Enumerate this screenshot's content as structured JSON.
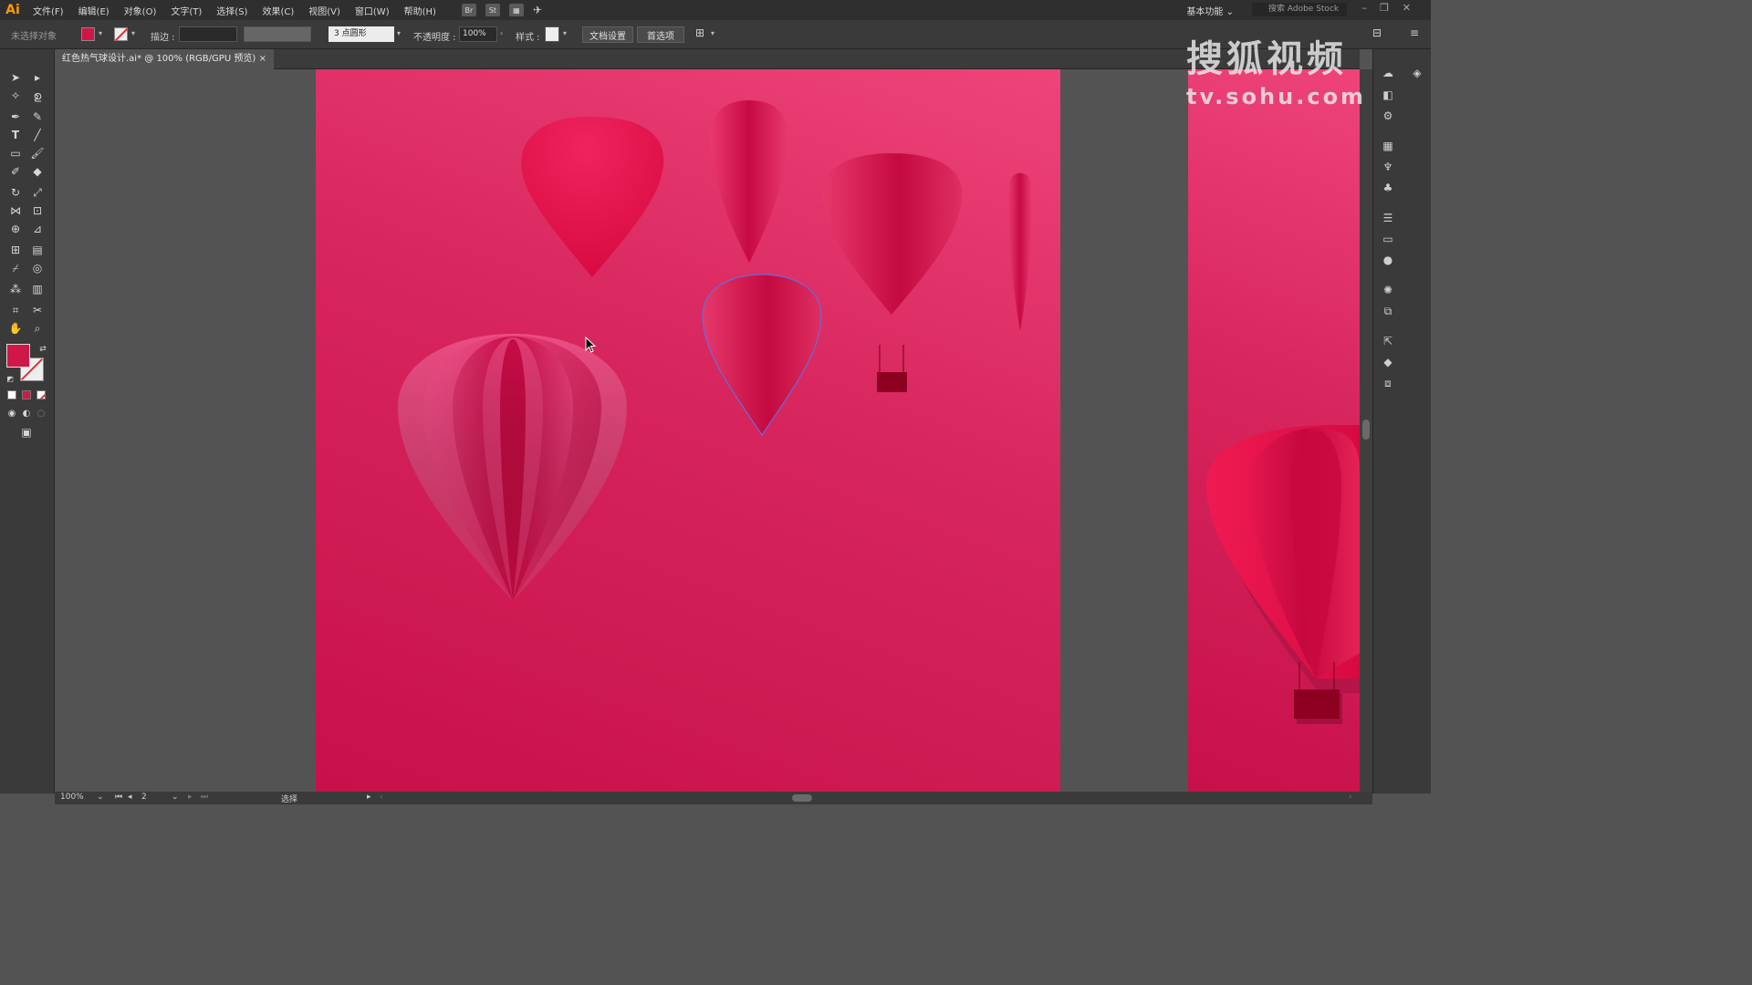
{
  "app": {
    "logo": "Ai"
  },
  "menu": [
    "文件(F)",
    "编辑(E)",
    "对象(O)",
    "文字(T)",
    "选择(S)",
    "效果(C)",
    "视图(V)",
    "窗口(W)",
    "帮助(H)"
  ],
  "menubar_icons": {
    "bridge": "Br",
    "stock": "St"
  },
  "workspace": {
    "label": "基本功能"
  },
  "stock_search": {
    "placeholder": "搜索 Adobe Stock"
  },
  "control_bar": {
    "selection_label": "未选择对象",
    "stroke_label": "描边 :",
    "brush_value": "3 点圆形",
    "opacity_label": "不透明度 :",
    "opacity_value": "100%",
    "style_label": "样式 :",
    "doc_setup_button": "文档设置",
    "preferences_button": "首选项"
  },
  "document_tab": {
    "title": "红色热气球设计.ai* @ 100% (RGB/GPU 预览)",
    "close": "×"
  },
  "status_bar": {
    "zoom": "100%",
    "artboard_number": "2",
    "tool_status": "选择"
  },
  "watermark": {
    "logo_text": "搜狐视频",
    "url": "tv.sohu.com"
  },
  "colors": {
    "fill": "#d01747",
    "artboard_top": "#ee447a",
    "artboard_bottom": "#c8104a",
    "balloon_red": "#e0134a",
    "basket": "#8e0020",
    "selection_outline": "#6a6ad8"
  },
  "icons": {
    "tools": [
      "selection-tool-icon",
      "direct-selection-tool-icon",
      "magic-wand-icon",
      "lasso-icon",
      "pen-tool-icon",
      "curvature-tool-icon",
      "type-tool-icon",
      "line-tool-icon",
      "rectangle-tool-icon",
      "paintbrush-icon",
      "shaper-tool-icon",
      "eraser-icon",
      "rotate-tool-icon",
      "scale-tool-icon",
      "width-tool-icon",
      "free-transform-icon",
      "shape-builder-icon",
      "perspective-grid-icon",
      "mesh-tool-icon",
      "gradient-tool-icon",
      "eyedropper-icon",
      "blend-tool-icon",
      "symbol-sprayer-icon",
      "column-graph-icon",
      "artboard-tool-icon",
      "slice-tool-icon",
      "hand-tool-icon",
      "zoom-tool-icon"
    ],
    "panels": [
      "color-guide-icon",
      "brushes-icon",
      "symbols-icon",
      "graphic-styles-icon",
      "stroke-panel-icon",
      "gradient-panel-icon",
      "transparency-icon",
      "appearance-icon",
      "align-icon",
      "transform-icon",
      "export-icon",
      "layers-icon",
      "artboards-icon"
    ]
  }
}
